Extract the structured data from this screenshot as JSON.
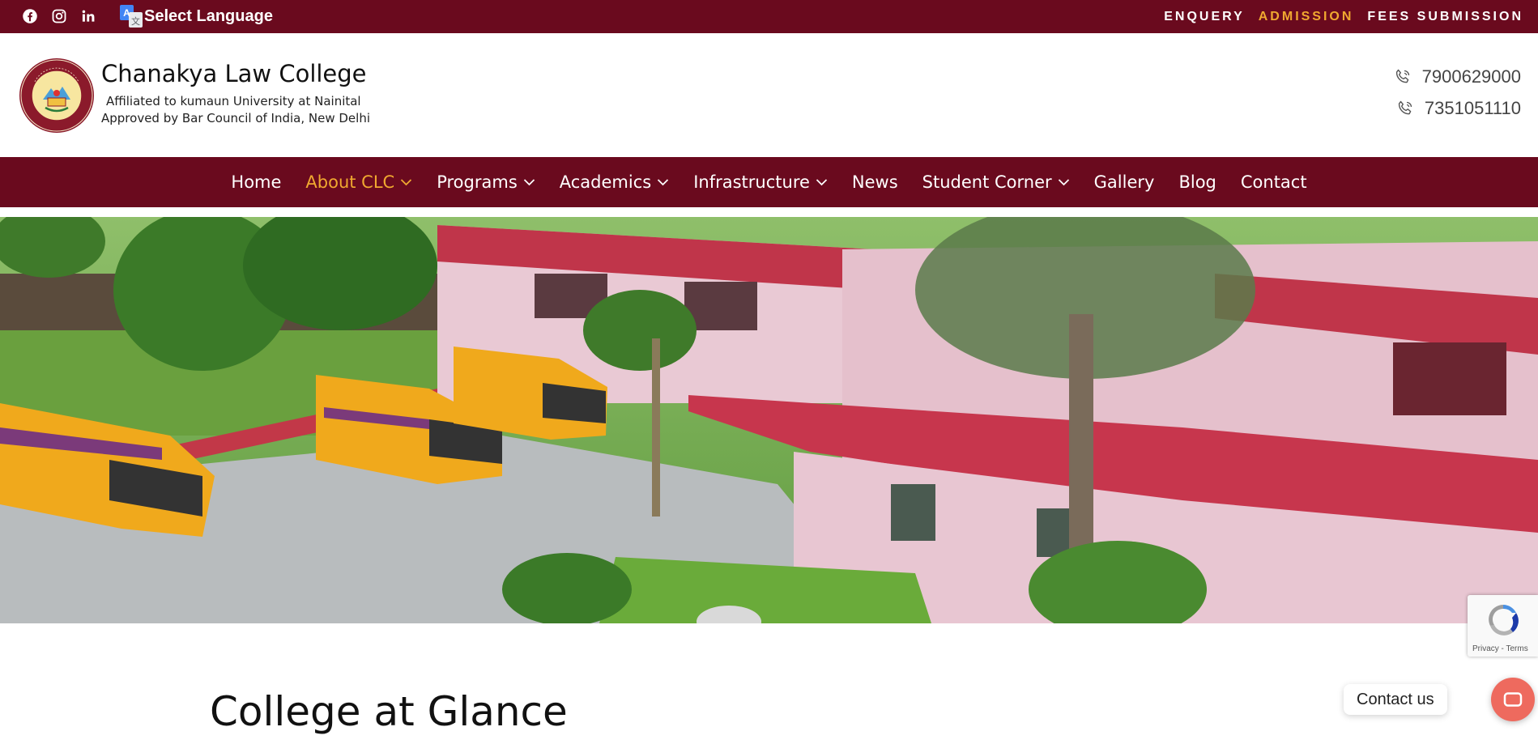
{
  "topbar": {
    "social": [
      {
        "icon": "facebook-icon"
      },
      {
        "icon": "instagram-icon"
      },
      {
        "icon": "linkedin-icon"
      }
    ],
    "language_label": "Select Language",
    "links": [
      "ENQUERY",
      "ADMISSION",
      "FEES SUBMISSION"
    ],
    "active_link": "ADMISSION"
  },
  "header": {
    "college_name": "Chanakya Law College",
    "affiliation": "Affiliated to kumaun University at Nainital",
    "approval": "Approved by Bar Council of India, New Delhi",
    "phones": [
      "7900629000",
      "7351051110"
    ]
  },
  "nav": {
    "items": [
      {
        "label": "Home",
        "dropdown": false
      },
      {
        "label": "About CLC",
        "dropdown": true,
        "active": true
      },
      {
        "label": "Programs",
        "dropdown": true
      },
      {
        "label": "Academics",
        "dropdown": true
      },
      {
        "label": "Infrastructure",
        "dropdown": true
      },
      {
        "label": "News",
        "dropdown": false
      },
      {
        "label": "Student Corner",
        "dropdown": true
      },
      {
        "label": "Gallery",
        "dropdown": false
      },
      {
        "label": "Blog",
        "dropdown": false
      },
      {
        "label": "Contact",
        "dropdown": false
      }
    ]
  },
  "main": {
    "section_title": "College at Glance"
  },
  "recaptcha": {
    "links": "Privacy - Terms"
  },
  "contact_widget": {
    "label": "Contact us"
  },
  "colors": {
    "brand_maroon": "#6a0a1e",
    "accent_orange": "#f0a830",
    "contact_button": "#ee6a5e"
  }
}
